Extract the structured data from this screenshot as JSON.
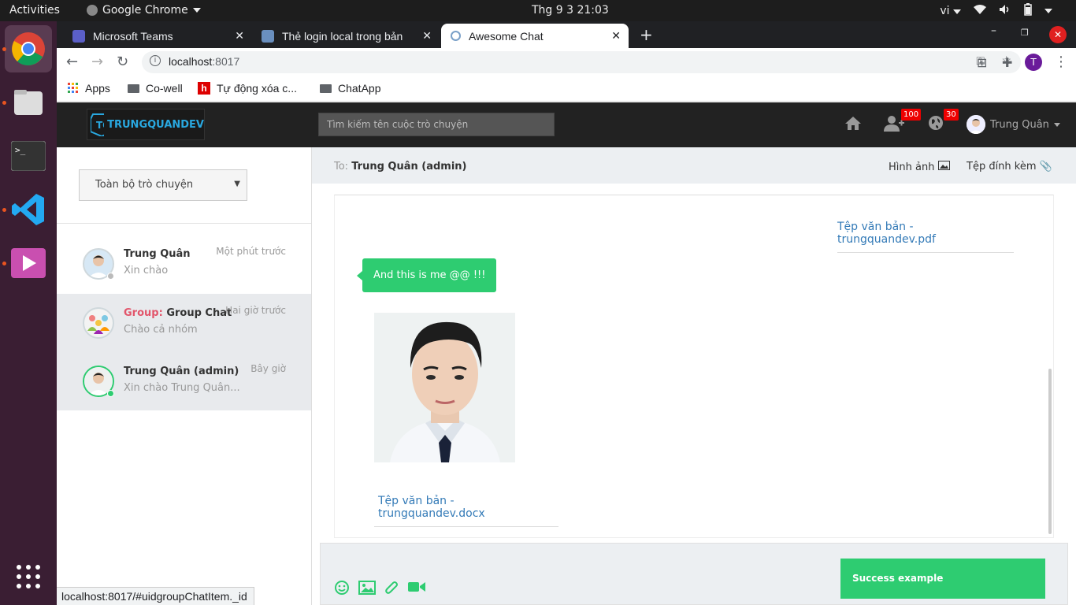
{
  "desktop": {
    "activities": "Activities",
    "app_menu": "Google Chrome",
    "clock": "Thg 9 3  21:03",
    "language": "vi"
  },
  "chrome": {
    "tabs": [
      {
        "title": "Microsoft Teams"
      },
      {
        "title": "Thẻ login local trong bản"
      },
      {
        "title": "Awesome Chat"
      }
    ],
    "url_host": "localhost",
    "url_port": ":8017",
    "profile_initial": "T",
    "bookmarks": [
      "Apps",
      "Co-well",
      "Tự động xóa c...",
      "ChatApp"
    ],
    "status_url": "localhost:8017/#uidgroupChatItem._id"
  },
  "app": {
    "logo_text": "TRUNGQUANDEV",
    "search_placeholder": "Tìm kiếm tên cuộc trò chuyện",
    "contact_badge": "100",
    "notif_badge": "30",
    "user_name": "Trung Quân",
    "filter_label": "Toàn bộ trò chuyện",
    "conversations": [
      {
        "name": "Trung Quân",
        "group_prefix": "",
        "time": "Một phút trước",
        "preview": "Xin chào",
        "status": "offline",
        "selected": false
      },
      {
        "name": "Group Chat",
        "group_prefix": "Group:",
        "time": "Hai giờ trước",
        "preview": "Chào cả nhóm",
        "status": "none",
        "selected": true
      },
      {
        "name": "Trung Quân (admin)",
        "group_prefix": "",
        "time": "Bây giờ",
        "preview": "Xin chào Trung Quân...",
        "status": "online",
        "selected": true
      }
    ],
    "header": {
      "to_label": "To:",
      "to_name": "Trung Quân (admin)",
      "images_link": "Hình ảnh",
      "attachments_link": "Tệp đính kèm"
    },
    "messages": {
      "file1": "Tệp văn bản - trungquandev.pdf",
      "text_bubble": "And this is me @@ !!!",
      "file2": "Tệp văn bản - trungquandev.docx"
    },
    "toast": "Success example",
    "colors": {
      "accent": "#2ecc71",
      "link": "#337ab7",
      "badge": "#ee0000",
      "group_label": "#e2556b"
    }
  }
}
